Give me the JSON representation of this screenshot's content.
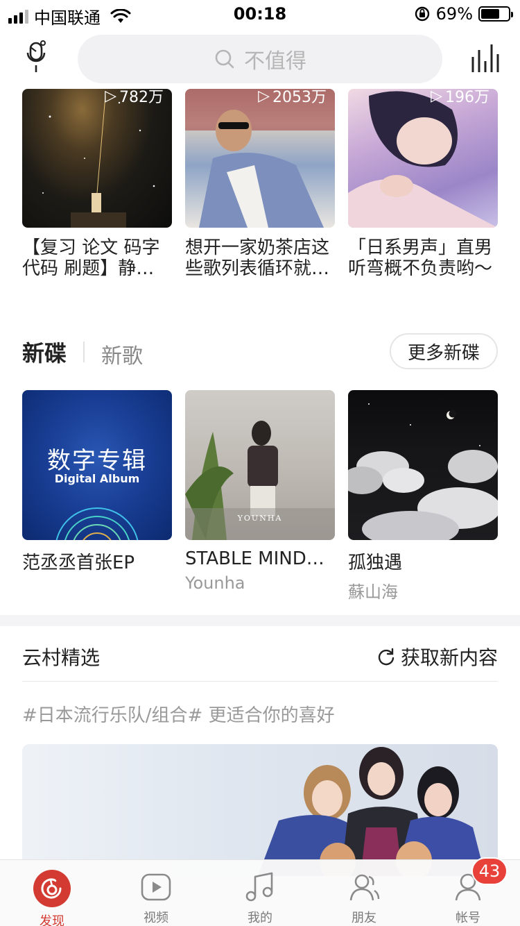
{
  "status_bar": {
    "carrier": "中国联通",
    "time": "00:18",
    "battery": "69%",
    "battery_level": 0.69
  },
  "search": {
    "placeholder": "不值得"
  },
  "playlists": [
    {
      "play_count": "782万",
      "title": "【复习 论文 码字 代码 刷题】静…"
    },
    {
      "play_count": "2053万",
      "title": "想开一家奶茶店这些歌列表循环就…"
    },
    {
      "play_count": "196万",
      "title": "「日系男声」直男听弯概不负责哟～"
    }
  ],
  "new_albums": {
    "tab_active": "新碟",
    "tab_inactive": "新歌",
    "more_button": "更多新碟",
    "items": [
      {
        "title": "范丞丞首张EP",
        "artist": "",
        "cover_text_main": "数字专辑",
        "cover_text_sub": "Digital Album"
      },
      {
        "title": "STABLE MINDS...",
        "artist": "Younha",
        "cover_text": "YOUNHA"
      },
      {
        "title": "孤独遇",
        "artist": "蘇山海"
      }
    ]
  },
  "yuncun": {
    "title": "云村精选",
    "refresh_label": "获取新内容",
    "tag_line": "#日本流行乐队/组合# 更适合你的喜好"
  },
  "tab_bar": {
    "tabs": [
      {
        "label": "发现",
        "icon": "netease-music-icon",
        "active": true
      },
      {
        "label": "视频",
        "icon": "video-play-icon"
      },
      {
        "label": "我的",
        "icon": "music-note-icon"
      },
      {
        "label": "朋友",
        "icon": "friends-icon"
      },
      {
        "label": "帐号",
        "icon": "account-icon"
      }
    ],
    "account_badge": "43"
  },
  "colors": {
    "accent": "#d33a31",
    "badge": "#e8413a",
    "search_bg": "#f1f1f3"
  }
}
